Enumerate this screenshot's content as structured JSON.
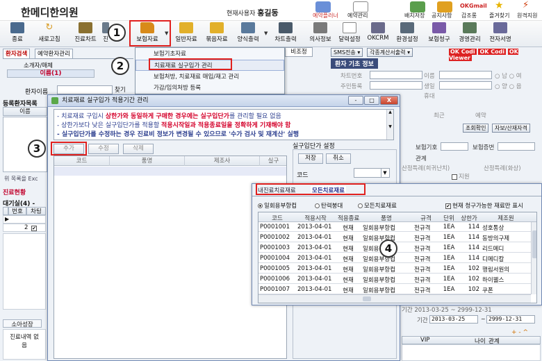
{
  "header": {
    "clinic_name": "한메디한의원",
    "current_user_label": "현재사용자",
    "current_user_name": "홍길동",
    "icons": [
      {
        "name": "reservation-board",
        "label": "예약플러너",
        "sub": "예약관리",
        "color": "#6a8fd8"
      },
      {
        "name": "schedule",
        "label": "예약관리",
        "sub": "",
        "color": "#888"
      },
      {
        "name": "placement",
        "label": "배치저장",
        "sub": "",
        "color": "#5a9e4c"
      },
      {
        "name": "notice",
        "label": "공지사항",
        "sub": "",
        "color": "#e0a020"
      },
      {
        "name": "okgmail",
        "label": "갑조롱",
        "sub": "OKGmail",
        "color": "#c22"
      },
      {
        "name": "favorites",
        "label": "즐겨찾기",
        "sub": "",
        "color": "#e8b400"
      },
      {
        "name": "remote-support",
        "label": "원격지원",
        "sub": "",
        "color": "#d04010"
      }
    ]
  },
  "toolbar": {
    "items": [
      {
        "label": "종료",
        "icon": "exit-icon",
        "color": "#4a6a8e"
      },
      {
        "label": "새로고침",
        "icon": "refresh-icon",
        "color": "#d89a20"
      },
      {
        "label": "진료차트",
        "icon": "chart-icon",
        "color": "#8a7030"
      },
      {
        "label": "진",
        "icon": "treatment-icon",
        "color": "#6a7a8a"
      },
      {
        "label": "보험자료",
        "icon": "insurance-folder-icon",
        "color": "#d88a1a"
      },
      {
        "label": "일반자료",
        "icon": "general-folder-icon",
        "color": "#e2b02a"
      },
      {
        "label": "묶음자료",
        "icon": "bundle-folder-icon",
        "color": "#e2b02a"
      },
      {
        "label": "양식출력",
        "icon": "print-form-icon",
        "color": "#5a7a9c"
      },
      {
        "label": "차트출력",
        "icon": "print-chart-icon",
        "color": "#4a5a6a"
      },
      {
        "label": "의사정보",
        "icon": "doctor-info-icon",
        "color": "#7a7a7a"
      },
      {
        "label": "달력설정",
        "icon": "calendar-icon",
        "color": "#8a8a8a"
      },
      {
        "label": "OKCRM",
        "icon": "crm-icon",
        "color": "#6a6a8a"
      },
      {
        "label": "환경설정",
        "icon": "settings-icon",
        "color": "#5a6a7a"
      },
      {
        "label": "보험청구",
        "icon": "claim-icon",
        "color": "#7a5aa8"
      },
      {
        "label": "경영관리",
        "icon": "management-icon",
        "color": "#5a7a5a"
      },
      {
        "label": "전자서명",
        "icon": "signature-icon",
        "color": "#6a6a9a"
      }
    ]
  },
  "callouts": [
    "1",
    "2",
    "3",
    "4"
  ],
  "left_panel": {
    "tab_search": "환자검색",
    "tab_reserve": "예약환자관리",
    "col_introducer": "소개자/매체",
    "col_name": "이름(1)",
    "patient_name_label": "환자이름",
    "search_button": "찾기",
    "registered_label": "등록환자목록",
    "col_name2": "이름",
    "bottom_label": "위 목록을 Exc",
    "status_label": "진료현황",
    "waiting_label": "대기실(4) -",
    "waiting_cols": [
      "번호",
      "차팅"
    ],
    "waiting_row_num": "2",
    "bottom_tabs": [
      "소아성장",
      "진료내역 없",
      "음"
    ]
  },
  "dropdown_menu": {
    "items": [
      "보험기초자료",
      "치료재료 실구입가 관리",
      "보험처방, 치료재료 매입/재고 관리",
      "가감/임의처방 등록"
    ]
  },
  "right_panel": {
    "left_label": "비조정",
    "sms_button": "SMS전송",
    "document_button": "각종계산서출력",
    "ok_buttons": [
      "Codi",
      "Codi",
      "Viewer"
    ],
    "patient_info_title": "환자 기초 정보",
    "fields": [
      "차트번호",
      "주민등록",
      "이름",
      "생일",
      "휴대",
      "최근",
      "예약"
    ],
    "gender_options": [
      "남",
      "여"
    ],
    "calendar_options": [
      "양",
      "음"
    ],
    "lookup_button": "조회확인",
    "qualification_label": "자보/산재자격",
    "insurance_code_label": "보험기호",
    "insurance_cert_label": "보험증번",
    "relation_label": "관계",
    "special_case_label": "산정특례(희귀난치)",
    "special_case2_label": "산정특례(화상)",
    "support_label": "지원",
    "period_label": "기간",
    "period_from": "2013-03-25",
    "period_to": "2999-12-31",
    "plus_minus": "+ - ^",
    "vip_col": "VIP",
    "age_col": "나이",
    "relation_col": "관계",
    "partial_row": "기간 2013-03-25 ~ 2999-12-31"
  },
  "dialog1": {
    "title": "치료재료 실구입가 적용기간 관리",
    "notices": [
      {
        "before": "치료재료 구입시 ",
        "highlight": "상한가와 동일하게 구매한 경우에는 실구입단가",
        "after": "를 관리할 필요 없음"
      },
      {
        "before": "상한가보다 낮은 실구입단가를 적용할 ",
        "highlight": "적용시작일과 적용종료일을 정확하게 기재해야 함",
        "after": ""
      },
      {
        "before": "실구입단가를 수정하는 경우 진료비 정보가 변경될 수 있으므로 '수가 검사 및 재계산' 실행",
        "highlight": "",
        "after": ""
      }
    ],
    "buttons": {
      "add": "추가",
      "edit": "수정",
      "delete": "삭제"
    },
    "grid_headers": [
      "코드",
      "품명",
      "제조사",
      "실구"
    ],
    "side_title": "실구입단가 설정",
    "save_button": "저장",
    "cancel_button": "취소",
    "code_label": "코드",
    "window_buttons": [
      "-",
      "□",
      "X"
    ]
  },
  "dialog2": {
    "tab_internal": "내진료치료재료",
    "tab_all": "모든치료재료",
    "filters": [
      "일회용부항컵",
      "탄력붕대",
      "모든치료재료"
    ],
    "checkbox_label": "현재 청구가능한 재료만 표시",
    "headers": [
      "코드",
      "적용시작",
      "적용종료",
      "품명",
      "규격",
      "단위",
      "상한가",
      "제조원"
    ],
    "rows": [
      {
        "code": "P0001001",
        "start": "2013-04-01",
        "end": "현재",
        "name": "일회용부항컵",
        "spec": "전규격",
        "unit": "1EA",
        "price": "114",
        "maker": "성호통상"
      },
      {
        "code": "P0001002",
        "start": "2013-04-01",
        "end": "현재",
        "name": "일회용부항컵",
        "spec": "전규격",
        "unit": "1EA",
        "price": "114",
        "maker": "동방의구제"
      },
      {
        "code": "P0001003",
        "start": "2013-04-01",
        "end": "현재",
        "name": "일회용부항컵",
        "spec": "전규격",
        "unit": "1EA",
        "price": "114",
        "maker": "리드메디"
      },
      {
        "code": "P0001004",
        "start": "2013-04-01",
        "end": "현재",
        "name": "일회용부항컵",
        "spec": "전규격",
        "unit": "1EA",
        "price": "114",
        "maker": "디메디칼"
      },
      {
        "code": "P0001005",
        "start": "2013-04-01",
        "end": "현재",
        "name": "일회용부항컵",
        "spec": "전규격",
        "unit": "1EA",
        "price": "102",
        "maker": "행림서원의"
      },
      {
        "code": "P0001006",
        "start": "2013-04-01",
        "end": "현재",
        "name": "일회용부항컵",
        "spec": "전규격",
        "unit": "1EA",
        "price": "102",
        "maker": "하이웰스"
      },
      {
        "code": "P0001007",
        "start": "2013-04-01",
        "end": "현재",
        "name": "일회용부항컵",
        "spec": "전규격",
        "unit": "1EA",
        "price": "102",
        "maker": "쿠폰"
      }
    ]
  }
}
